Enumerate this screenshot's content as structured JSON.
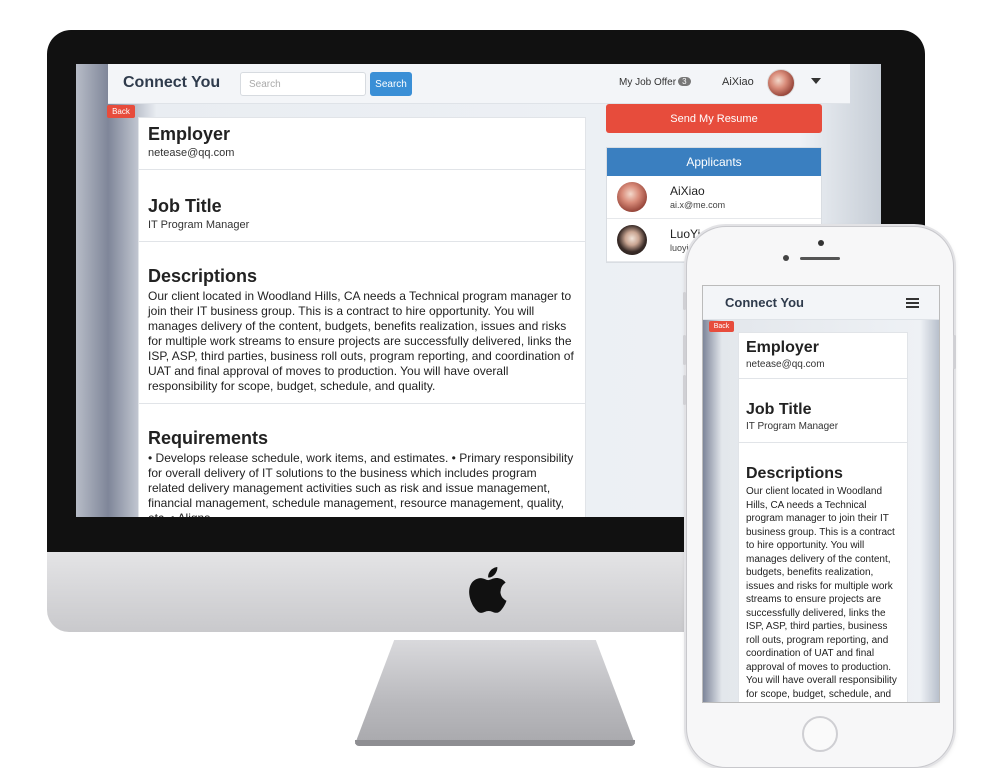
{
  "brand": "Connect You",
  "search": {
    "placeholder": "Search",
    "button": "Search"
  },
  "nav": {
    "job_offer_label": "My Job Offer",
    "job_offer_count": "3",
    "username": "AiXiao"
  },
  "back_label": "Back",
  "employer": {
    "heading": "Employer",
    "email": "netease@qq.com"
  },
  "job_title": {
    "heading": "Job Title",
    "value": "IT Program Manager"
  },
  "descriptions": {
    "heading": "Descriptions",
    "text": "Our client located in Woodland Hills, CA needs a Technical program manager to join their IT business group. This is a contract to hire opportunity. You will manages delivery of the content, budgets, benefits realization, issues and risks for multiple work streams to ensure projects are successfully delivered, links the ISP, ASP, third parties, business roll outs, program reporting, and coordination of UAT and final approval of moves to production. You will have overall responsibility for scope, budget, schedule, and quality."
  },
  "requirements": {
    "heading": "Requirements",
    "text": "• Develops release schedule, work items, and estimates. • Primary responsibility for overall delivery of IT solutions to the business which includes program related delivery management activities such as risk and issue management, financial management, schedule management, resource management, quality, etc. • Aligns"
  },
  "send_resume": "Send My Resume",
  "applicants": {
    "heading": "Applicants",
    "items": [
      {
        "name": "AiXiao",
        "email": "ai.x@me.com"
      },
      {
        "name": "LuoYi",
        "email": "luoyi"
      }
    ]
  },
  "icons": {
    "menu": "hamburger-menu-icon",
    "caret": "caret-down-icon",
    "apple": "apple-logo-icon"
  },
  "colors": {
    "accent_blue": "#3a8fd6",
    "danger_red": "#e74c3c",
    "panel_blue": "#3a7fc0"
  }
}
